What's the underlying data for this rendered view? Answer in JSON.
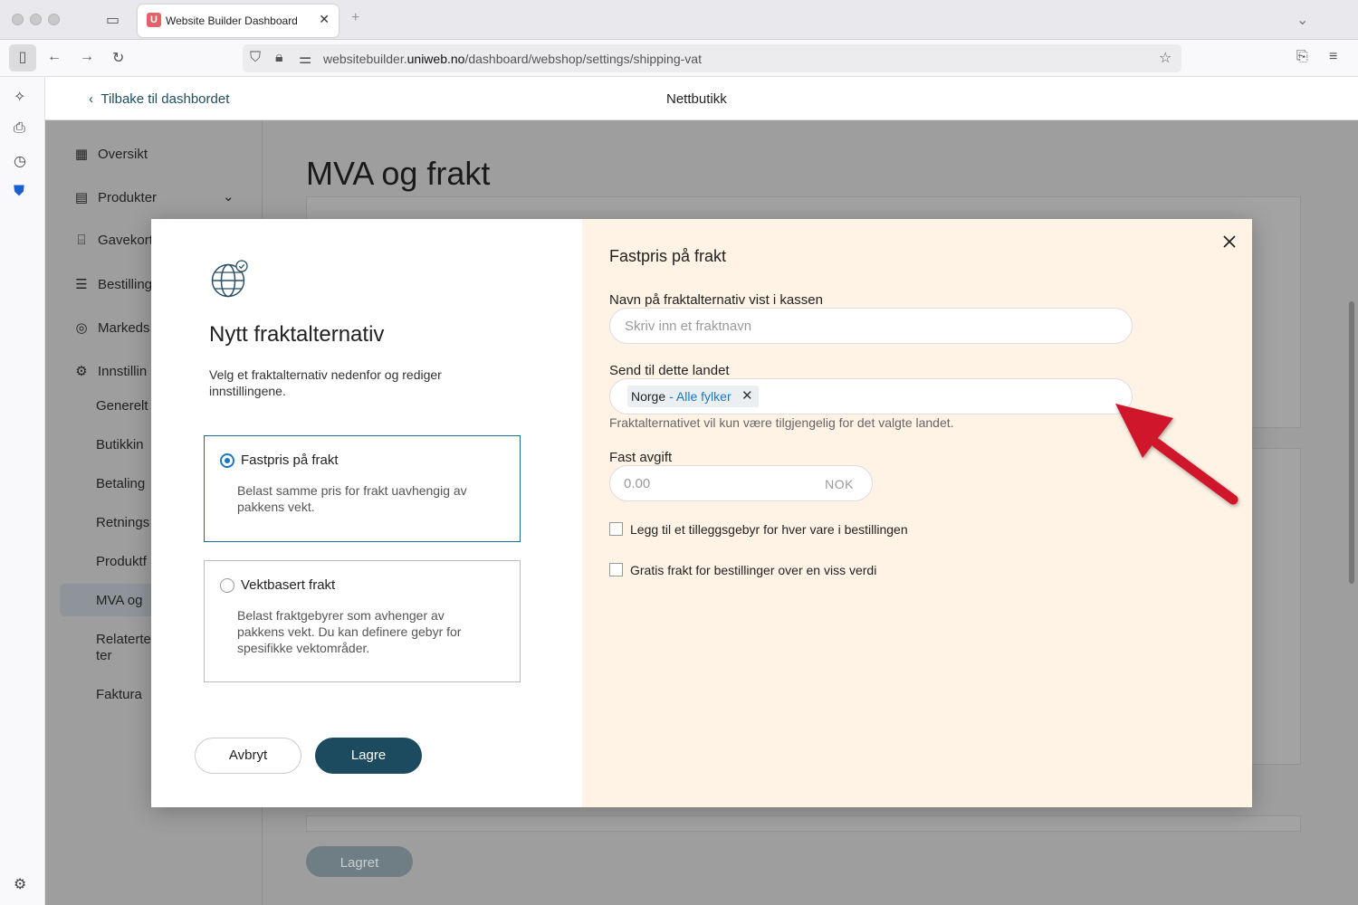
{
  "browser": {
    "tab_title": "Website Builder Dashboard",
    "tab_favicon": "U",
    "url_prefix": "websitebuilder.",
    "url_domain": "uniweb.no",
    "url_path": "/dashboard/webshop/settings/shipping-vat"
  },
  "header": {
    "back_label": "Tilbake til dashbordet",
    "title": "Nettbutikk"
  },
  "sidebar": {
    "items": [
      {
        "label": "Oversikt",
        "icon": "grid-icon"
      },
      {
        "label": "Produkter",
        "icon": "box-icon"
      },
      {
        "label": "Gavekort",
        "icon": "gift-icon"
      },
      {
        "label": "Bestilling",
        "icon": "list-icon"
      },
      {
        "label": "Markeds",
        "icon": "target-icon"
      },
      {
        "label": "Innstillin",
        "icon": "gear-icon"
      }
    ],
    "subitems": [
      "Generelt",
      "Butikkin",
      "Betaling",
      "Retnings",
      "Produktf",
      "MVA og",
      "Relaterte",
      "ter",
      "Faktura"
    ]
  },
  "page": {
    "title": "MVA og frakt",
    "saved_label": "Lagret"
  },
  "modal": {
    "title": "Nytt fraktalternativ",
    "description": "Velg et fraktalternativ nedenfor og rediger innstillingene.",
    "options": [
      {
        "title": "Fastpris på frakt",
        "desc": "Belast samme pris for frakt uavhengig av pakkens vekt.",
        "selected": true
      },
      {
        "title": "Vektbasert frakt",
        "desc": "Belast fraktgebyrer som avhenger av pakkens vekt. Du kan definere gebyr for spesifikke vektområder.",
        "selected": false
      }
    ],
    "cancel_label": "Avbryt",
    "save_label": "Lagre",
    "form": {
      "heading": "Fastpris på frakt",
      "name_label": "Navn på fraktalternativ vist i kassen",
      "name_placeholder": "Skriv inn et fraktnavn",
      "country_label": "Send til dette landet",
      "country_chip": "Norge",
      "country_chip_sub": "- Alle fylker",
      "country_help": "Fraktalternativet vil kun være tilgjengelig for det valgte landet.",
      "fee_label": "Fast avgift",
      "fee_value": "0.00",
      "fee_unit": "NOK",
      "checkbox_1": "Legg til et tilleggsgebyr for hver vare i bestillingen",
      "checkbox_2": "Gratis frakt for bestillinger over en viss verdi"
    }
  },
  "colors": {
    "accent": "#1c4a5e",
    "link": "#1b78c0",
    "panel": "#fff3e5",
    "arrow": "#d0142c"
  }
}
